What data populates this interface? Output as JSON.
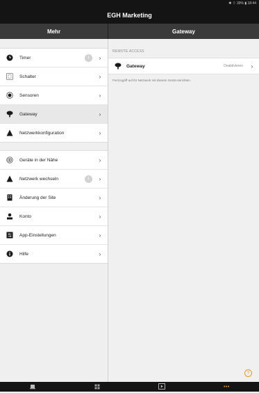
{
  "statusbar": {
    "text": "✱ ⌔ 39% ▮ 18:44"
  },
  "app": {
    "title": "EGH Marketing"
  },
  "header": {
    "left_title": "Mehr",
    "right_title": "Gateway"
  },
  "sidebar": {
    "group1": [
      {
        "label": "Timer",
        "icon": "clock-icon",
        "badge": "1"
      },
      {
        "label": "Schalter",
        "icon": "switch-icon"
      },
      {
        "label": "Sensoren",
        "icon": "sensor-icon"
      },
      {
        "label": "Gateway",
        "icon": "gateway-icon",
        "selected": true
      },
      {
        "label": "Netzwerkkonfiguration",
        "icon": "network-icon"
      }
    ],
    "group2": [
      {
        "label": "Geräte in der Nähe",
        "icon": "nearby-icon"
      },
      {
        "label": "Netzwerk wechseln",
        "icon": "network-icon",
        "badge": "1"
      },
      {
        "label": "Änderung der Site",
        "icon": "building-icon"
      },
      {
        "label": "Konto",
        "icon": "person-icon"
      },
      {
        "label": "App-Einstellungen",
        "icon": "settings-icon"
      },
      {
        "label": "Hilfe",
        "icon": "info-icon"
      }
    ],
    "chevron": "›"
  },
  "content": {
    "section_title": "REMOTE ACCESS",
    "remote_row": {
      "label": "Gateway",
      "status": "Deaktivieren",
      "chevron": "›"
    },
    "note": "Fernzugriff auf Ihr Netzwerk mit diesem Gerät einrichten.",
    "help_glyph": "?"
  },
  "tabbar": {
    "tabs": [
      "home-icon",
      "grid-icon",
      "media-icon",
      "more-icon"
    ],
    "more_label": "•••"
  },
  "colors": {
    "accent": "#e69a2e",
    "dark": "#141414",
    "header": "#3a3a3a"
  }
}
